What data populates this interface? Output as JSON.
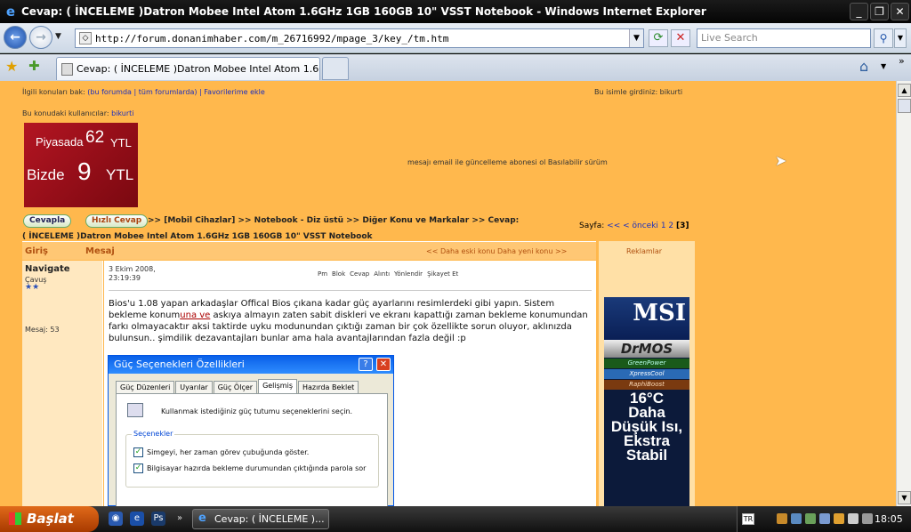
{
  "window": {
    "title": "Cevap: ( İNCELEME )Datron Mobee Intel Atom 1.6GHz 1GB 160GB 10\" VSST Notebook - Windows Internet Explorer",
    "minimize": "_",
    "maximize": "❐",
    "close": "✕"
  },
  "nav": {
    "url": "http://forum.donanimhaber.com/m_26716992/mpage_3/key_/tm.htm",
    "search_placeholder": "Live Search",
    "back": "←",
    "forward": "→"
  },
  "tabs": [
    {
      "label": "Cevap: ( İNCELEME )Datron Mobee Intel Atom 1.6GH..."
    }
  ],
  "page": {
    "related_prefix": "İlgili konuları bak:",
    "related_links": "(bu forumda | tüm forumlarda) | Favorilerime ekle",
    "signed_in": "Bu isimle girdiniz: bikurti",
    "users_prefix": "Bu konudaki kullanıcılar:",
    "users_link": "bikurti",
    "banner": {
      "line1": "Piyasada",
      "num1": "62",
      "cur1": "YTL",
      "line2": "Bizde",
      "num2": "9",
      "cur2": "YTL"
    },
    "notify": "mesajı email ile güncelleme abonesi ol Basılabilir sürüm",
    "reply_button": "Cevapla",
    "quick_reply_button": "Hızlı Cevap",
    "breadcrumb_1": ">> [Mobil Cihazlar] >> Notebook - Diz üstü >> Diğer Konu ve Markalar >> Cevap:",
    "breadcrumb_2": "( İNCELEME )Datron Mobee Intel Atom 1.6GHz 1GB 160GB 10\" VSST Notebook",
    "pager_label": "Sayfa:",
    "pager_prev_all": "<<",
    "pager_prev": "< önceki",
    "pager_pages": "1 2",
    "pager_current": "[3]",
    "col_from": "Giriş",
    "col_msg": "Mesaj",
    "topic_nav": "<< Daha eski konu    Daha yeni konu >>",
    "ads_label": "Reklamlar"
  },
  "post": {
    "author": "Navigate",
    "rank": "Çavuş",
    "stars": "★★",
    "msg_count": "Mesaj: 53",
    "date_line1": "3 Ekim 2008,",
    "date_line2": "23:19:39",
    "actions": [
      "Pm",
      "Blok",
      "Cevap",
      "Alıntı",
      "Yönlendir",
      "Şikayet Et"
    ],
    "text_before": "Bios'u 1.08 yapan arkadaşlar Offical Bios çıkana kadar güç ayarlarını resimlerdeki gibi yapın. Sistem bekleme konum",
    "text_underlined": "una ve",
    "text_after": " askıya almayın zaten sabit diskleri ve ekranı kapattığı zaman bekleme konumundan farkı olmayacaktır aksi taktirde uyku modunundan çıktığı zaman bir çok özellikte sorun oluyor, aklınızda bulunsun.. şimdilik dezavantajları bunlar ama hala avantajlarından fazla değil :p"
  },
  "dialog": {
    "title": "Güç Seçenekleri Özellikleri",
    "tabs": [
      "Güç Düzenleri",
      "Uyarılar",
      "Güç Ölçer",
      "Gelişmiş",
      "Hazırda Beklet"
    ],
    "active_tab": "Gelişmiş",
    "prompt": "Kullanmak istediğiniz güç tutumu seçeneklerini seçin.",
    "group_label": "Seçenekler",
    "option1": "Simgeyi, her zaman görev çubuğunda göster.",
    "option2": "Bilgisayar hazırda bekleme durumundan çıktığında parola sor"
  },
  "ad": {
    "brand": "MSI",
    "brand_tag": "",
    "drmos": "DrMOS",
    "g1": "GreenPower",
    "g2": "XpressCool",
    "g3": "RaphiBoost",
    "temp": "16°C",
    "text": "Daha Düşük Isı, Ekstra Stabil"
  },
  "taskbar": {
    "start": "Başlat",
    "window_button": "Cevap: ( İNCELEME )...",
    "lang": "TR",
    "clock": "18:05"
  },
  "colors": {
    "page_bg": "#ffb84d",
    "accent": "#b05010",
    "link": "#1b2fbf"
  }
}
